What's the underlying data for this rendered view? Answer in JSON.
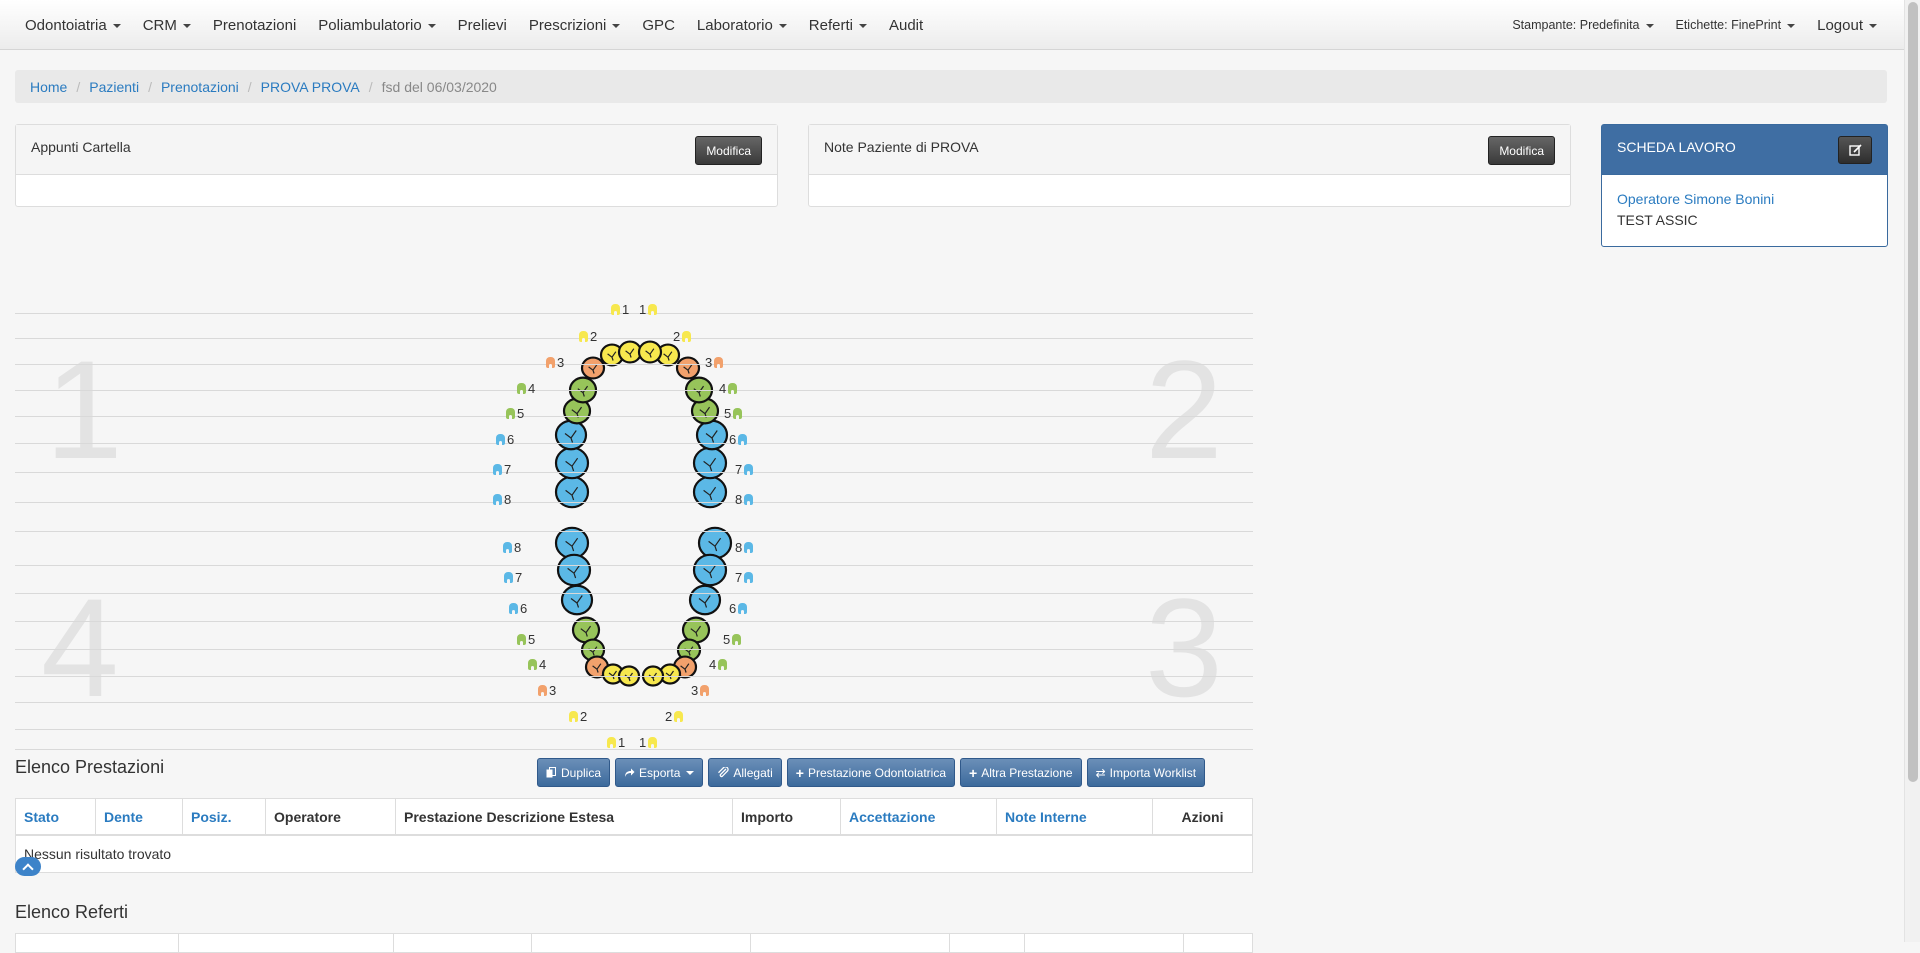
{
  "navbar": {
    "left_items": [
      {
        "label": "Odontoiatria",
        "dropdown": true
      },
      {
        "label": "CRM",
        "dropdown": true
      },
      {
        "label": "Prenotazioni",
        "dropdown": false
      },
      {
        "label": "Poliambulatorio",
        "dropdown": true
      },
      {
        "label": "Prelievi",
        "dropdown": false
      },
      {
        "label": "Prescrizioni",
        "dropdown": true
      },
      {
        "label": "GPC",
        "dropdown": false
      },
      {
        "label": "Laboratorio",
        "dropdown": true
      },
      {
        "label": "Referti",
        "dropdown": true
      },
      {
        "label": "Audit",
        "dropdown": false
      }
    ],
    "printer": "Stampante: Predefinita",
    "labels": "Etichette: FinePrint",
    "logout": "Logout"
  },
  "breadcrumb": {
    "items": [
      "Home",
      "Pazienti",
      "Prenotazioni",
      "PROVA PROVA"
    ],
    "current": "fsd del 06/03/2020"
  },
  "appunti": {
    "title": "Appunti Cartella",
    "button": "Modifica"
  },
  "note_paziente": {
    "title": "Note Paziente di  PROVA",
    "button": "Modifica"
  },
  "scheda_lavoro": {
    "title": "SCHEDA LAVORO",
    "operator": "Operatore Simone Bonini",
    "detail": "TEST ASSIC"
  },
  "tooth_chart": {
    "quadrants": [
      "1",
      "2",
      "3",
      "4"
    ],
    "tooth_numbers": [
      "1",
      "2",
      "3",
      "4",
      "5",
      "6",
      "7",
      "8"
    ],
    "colors": {
      "incisor": "#f7e84e",
      "canine": "#f2a16c",
      "premolar": "#97c45a",
      "molar": "#5bb8e6"
    }
  },
  "prestazioni": {
    "title": "Elenco Prestazioni",
    "buttons": {
      "duplica": "Duplica",
      "esporta": "Esporta",
      "allegati": "Allegati",
      "prestazione_odontoiatrica": "Prestazione Odontoiatrica",
      "altra_prestazione": "Altra Prestazione",
      "importa_worklist": "Importa Worklist"
    },
    "columns": [
      "Stato",
      "Dente",
      "Posiz.",
      "Operatore",
      "Prestazione Descrizione Estesa",
      "Importo",
      "Accettazione",
      "Note Interne",
      "Azioni"
    ],
    "empty": "Nessun risultato trovato"
  },
  "referti": {
    "title": "Elenco Referti"
  }
}
